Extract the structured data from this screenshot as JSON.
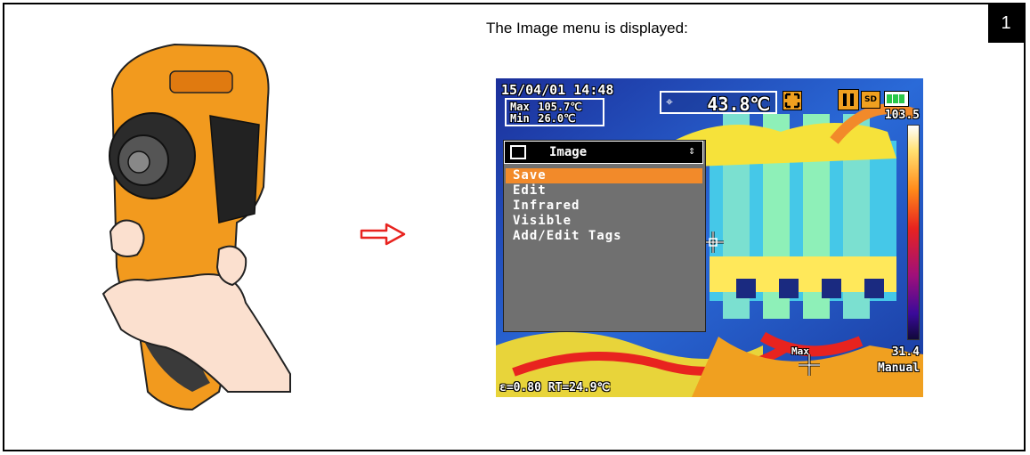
{
  "step": {
    "number": "1"
  },
  "caption": "The Image menu is displayed:",
  "screen": {
    "datetime": "15/04/01 14:48",
    "max": {
      "label": "Max",
      "value": "105.7℃"
    },
    "min": {
      "label": "Min",
      "value": "26.0℃"
    },
    "spot_temp": "43.8℃",
    "scale_max": "103.5",
    "scale_min": "31.4",
    "mode": "Manual",
    "emissivity_status": "ε=0.80 RT=24.9℃",
    "max_marker_label": "Max",
    "sd_label": "SD"
  },
  "menu": {
    "title": "Image",
    "items": [
      {
        "label": "Save",
        "selected": true
      },
      {
        "label": "Edit"
      },
      {
        "label": "Infrared"
      },
      {
        "label": "Visible"
      },
      {
        "label": "Add/Edit Tags"
      }
    ]
  },
  "colors": {
    "highlight": "#f28a2a",
    "camera_body": "#f29a1e",
    "arrow": "#e8231f"
  }
}
